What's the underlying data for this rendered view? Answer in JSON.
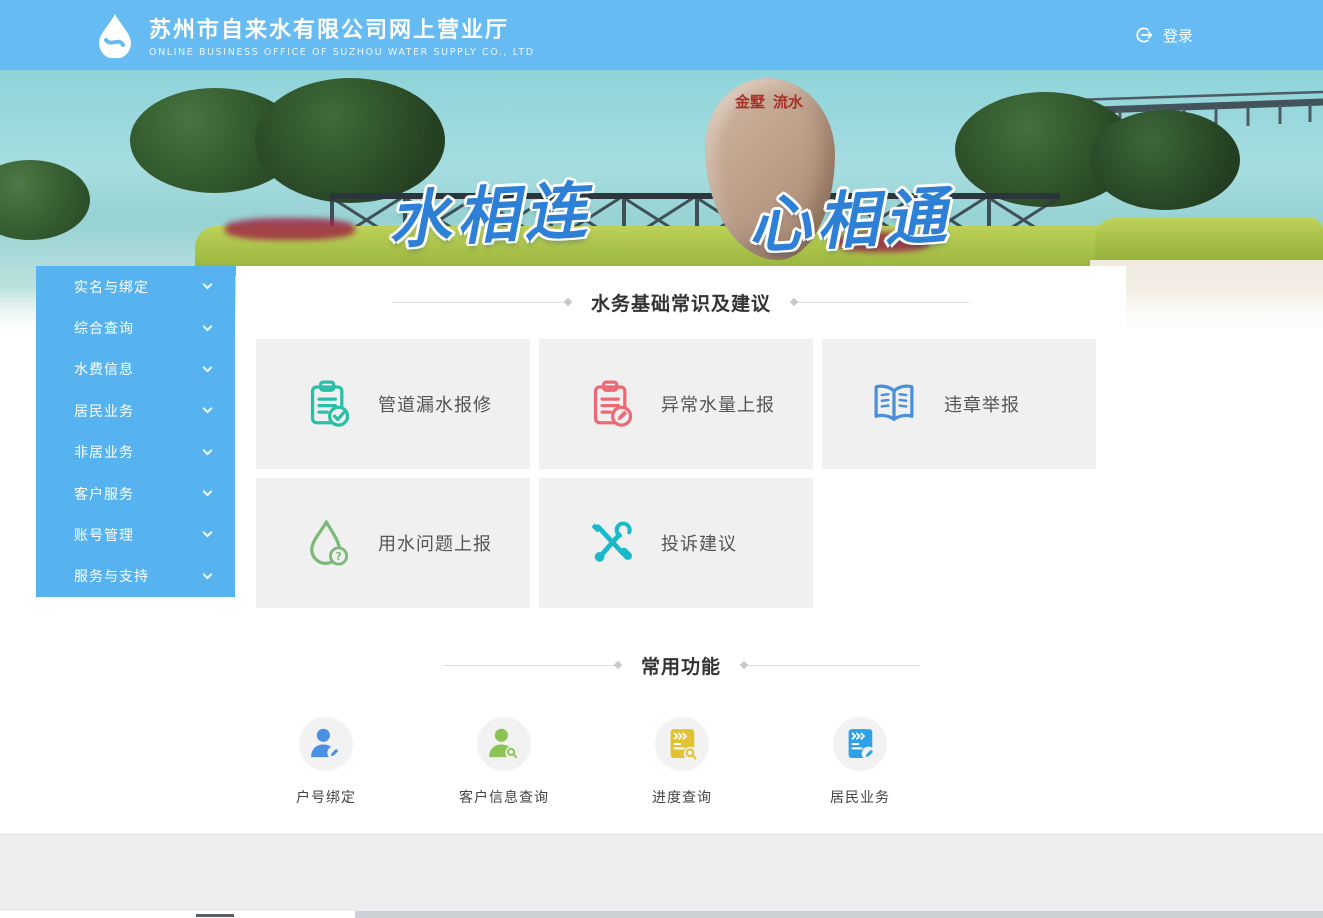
{
  "header": {
    "title": "苏州市自来水有限公司网上营业厅",
    "subtitle": "ONLINE BUSINESS OFFICE OF SUZHOU WATER SUPPLY CO., LTD",
    "login_label": "登录"
  },
  "hero": {
    "slogan_left": "水相连",
    "slogan_right": "心相通",
    "stone_text_col1": "金墅",
    "stone_text_col2": "流水"
  },
  "sidebar": {
    "items": [
      {
        "label": "实名与绑定"
      },
      {
        "label": "综合查询"
      },
      {
        "label": "水费信息"
      },
      {
        "label": "居民业务"
      },
      {
        "label": "非居业务"
      },
      {
        "label": "客户服务"
      },
      {
        "label": "账号管理"
      },
      {
        "label": "服务与支持"
      }
    ]
  },
  "main": {
    "section1_title": "水务基础常识及建议",
    "cards": [
      {
        "label": "管道漏水报修",
        "icon": "clipboard-check-icon",
        "color": "#2cbfa7"
      },
      {
        "label": "异常水量上报",
        "icon": "clipboard-edit-icon",
        "color": "#ec6a75"
      },
      {
        "label": "违章举报",
        "icon": "open-book-icon",
        "color": "#4a90d9"
      },
      {
        "label": "用水问题上报",
        "icon": "waterdrop-question-icon",
        "color": "#7cb979"
      },
      {
        "label": "投诉建议",
        "icon": "tools-icon",
        "color": "#19b9cc"
      }
    ],
    "section2_title": "常用功能",
    "quick_links": [
      {
        "label": "户号绑定",
        "icon": "user-edit-icon",
        "color": "#4a8fe2"
      },
      {
        "label": "客户信息查询",
        "icon": "user-search-icon",
        "color": "#8bc455"
      },
      {
        "label": "进度查询",
        "icon": "progress-search-icon",
        "color": "#e3c230"
      },
      {
        "label": "居民业务",
        "icon": "resident-business-icon",
        "color": "#2ea2e8"
      }
    ]
  },
  "colors": {
    "header_bg": "#66bcf2",
    "sidebar_bg": "#57b3ef",
    "card_bg": "#f0f0f0",
    "slogan_blue": "#2e7fd6",
    "footer_bg": "#ededef"
  }
}
